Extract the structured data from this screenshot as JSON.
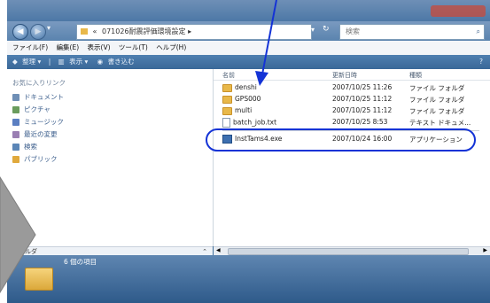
{
  "address": {
    "path_prefix": "«",
    "path": "071026耐震評価環境設定 ▸",
    "search_placeholder": "検索"
  },
  "menu": {
    "file": "ファイル(F)",
    "edit": "編集(E)",
    "view": "表示(V)",
    "tools": "ツール(T)",
    "help": "ヘルプ(H)"
  },
  "toolbar": {
    "organize": "整理 ▾",
    "views": "表示 ▾",
    "burn": "書き込む"
  },
  "sidebar": {
    "header": "お気に入りリンク",
    "items": [
      {
        "label": "ドキュメント",
        "color": "#6f8fb6"
      },
      {
        "label": "ピクチャ",
        "color": "#6a9c5d"
      },
      {
        "label": "ミュージック",
        "color": "#5b7fc2"
      },
      {
        "label": "最近の変更",
        "color": "#9a7fb3"
      },
      {
        "label": "検索",
        "color": "#5b86b7"
      },
      {
        "label": "パブリック",
        "color": "#e0a93d"
      }
    ],
    "folders_label": "フォルダ"
  },
  "file_list": {
    "columns": {
      "name": "名前",
      "date": "更新日時",
      "type": "種類"
    },
    "rows": [
      {
        "name": "denshi",
        "date": "2007/10/25 11:26",
        "type": "ファイル フォルダ",
        "icon": "folder-icon"
      },
      {
        "name": "GPS000",
        "date": "2007/10/25 11:12",
        "type": "ファイル フォルダ",
        "icon": "folder-icon"
      },
      {
        "name": "multi",
        "date": "2007/10/25 11:12",
        "type": "ファイル フォルダ",
        "icon": "folder-icon"
      },
      {
        "name": "batch_job.txt",
        "date": "2007/10/25 8:53",
        "type": "テキスト ドキュメ...",
        "icon": "text-file-icon"
      },
      {
        "name": "InstTams4.exe",
        "date": "2007/10/24 16:00",
        "type": "アプリケーション",
        "icon": "application-icon"
      }
    ]
  },
  "status": {
    "count": "6 個の項目"
  },
  "colors": {
    "annotation_blue": "#1433d6",
    "gray_arrow": "#9a9a9a"
  }
}
